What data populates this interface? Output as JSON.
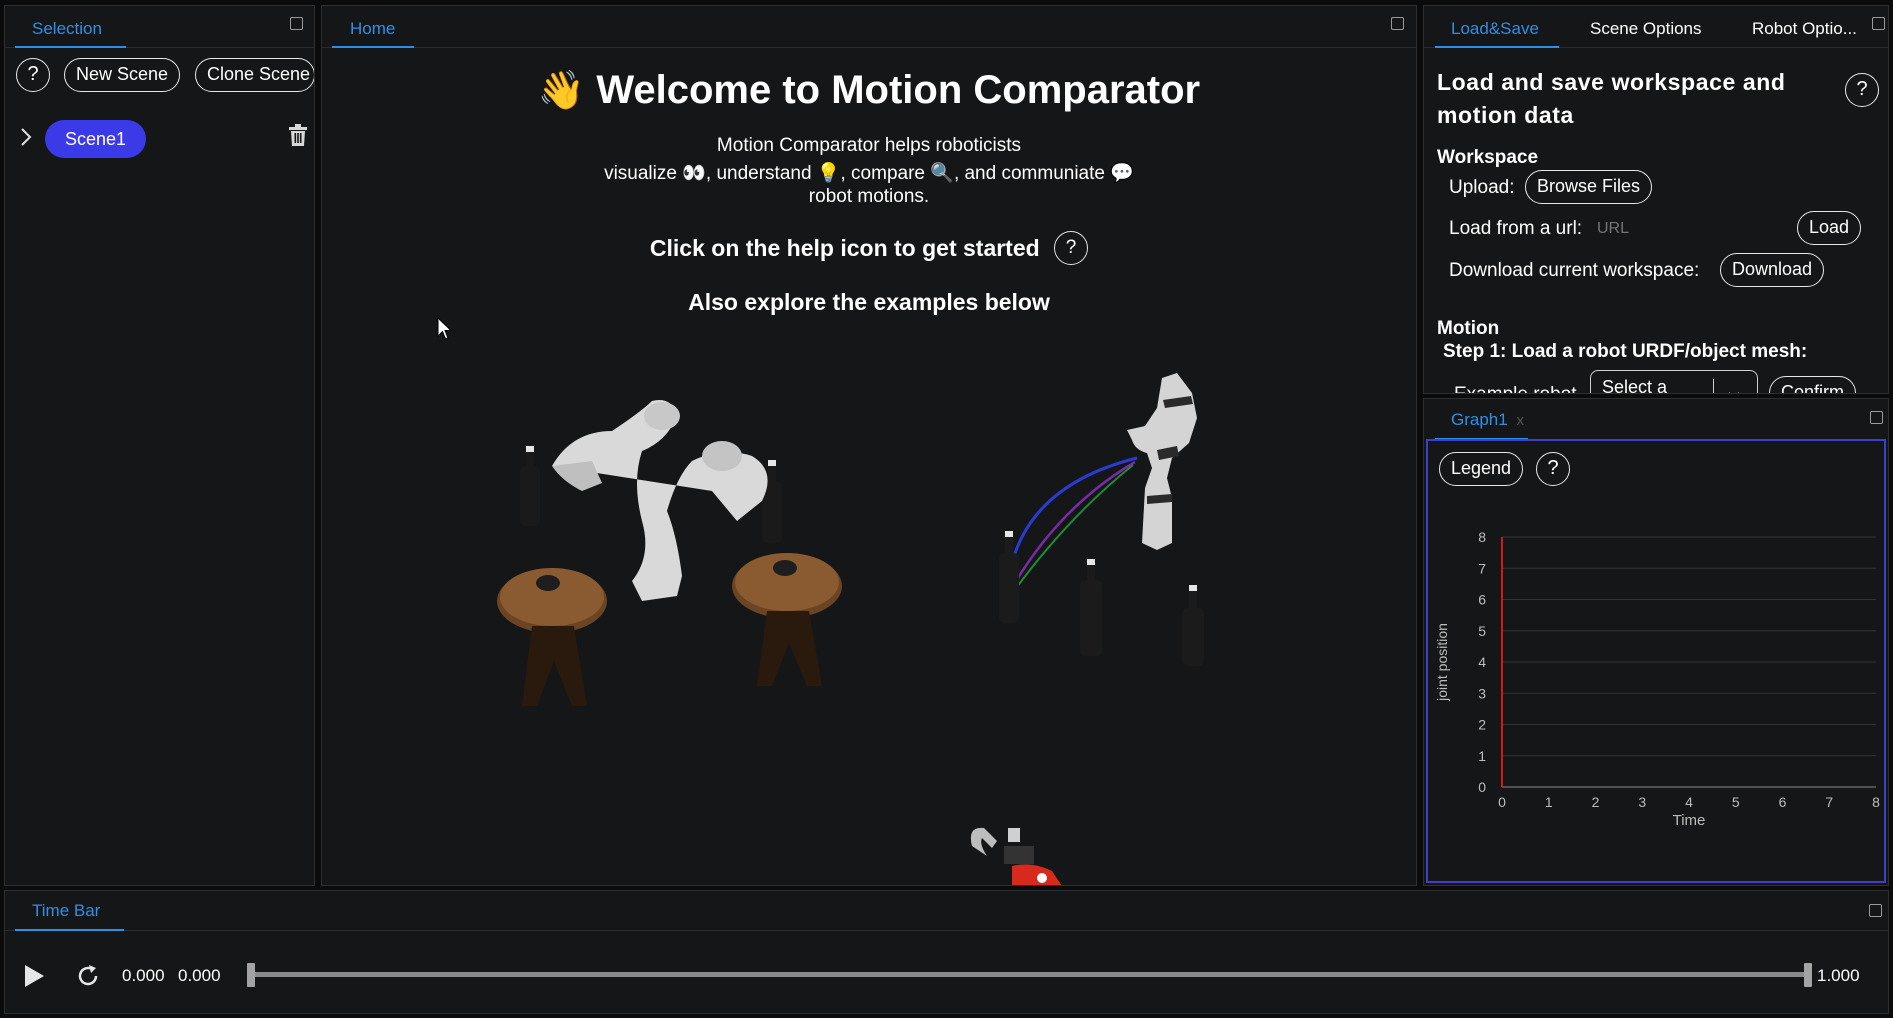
{
  "selection": {
    "tab_label": "Selection",
    "help": "?",
    "new_scene_label": "New Scene",
    "clone_scene_label": "Clone Scene",
    "scene_label": "Scene1"
  },
  "home": {
    "tab_label": "Home",
    "title": "Welcome to Motion Comparator",
    "intro_line1": "Motion Comparator helps roboticists",
    "intro_line2_a": "visualize",
    "intro_line2_b": ", understand",
    "intro_line2_c": ", compare",
    "intro_line2_d": ", and communiate",
    "intro_line3": "robot motions.",
    "help_prompt": "Click on the help icon to get started",
    "help": "?",
    "examples_prompt": "Also explore the examples below"
  },
  "right_top": {
    "tabs": [
      "Load&Save",
      "Scene Options",
      "Robot Optio..."
    ],
    "title": "Load and save workspace and motion data",
    "help": "?",
    "workspace_heading": "Workspace",
    "upload_label": "Upload:",
    "browse_label": "Browse Files",
    "load_url_label": "Load from a url:",
    "url_placeholder": "URL",
    "load_button": "Load",
    "download_label": "Download current workspace:",
    "download_button": "Download",
    "motion_heading": "Motion",
    "step1_label": "Step 1: Load a robot URDF/object mesh:",
    "example_robot_label": "Example robot",
    "select_placeholder": "Select a",
    "confirm_button": "Confirm"
  },
  "graph": {
    "tab_label": "Graph1",
    "close_label": "x",
    "legend_label": "Legend",
    "help": "?"
  },
  "chart_data": {
    "type": "line",
    "xlabel": "Time",
    "ylabel": "joint position",
    "xlim": [
      0,
      8
    ],
    "ylim": [
      0,
      8
    ],
    "x_ticks": [
      "0",
      "1",
      "2",
      "3",
      "4",
      "5",
      "6",
      "7",
      "8"
    ],
    "y_ticks": [
      "0",
      "1",
      "2",
      "3",
      "4",
      "5",
      "6",
      "7",
      "8"
    ],
    "grid": true,
    "current_time_marker": 0,
    "series": []
  },
  "timebar": {
    "tab_label": "Time Bar",
    "current_time": "0.000",
    "start_time": "0.000",
    "end_time": "1.000",
    "progress": 0
  },
  "colors": {
    "accent": "#2f8fe8",
    "scene_button": "#3a3ae8",
    "graph_frame": "#3b3fc9",
    "time_marker": "#d11a1a"
  }
}
